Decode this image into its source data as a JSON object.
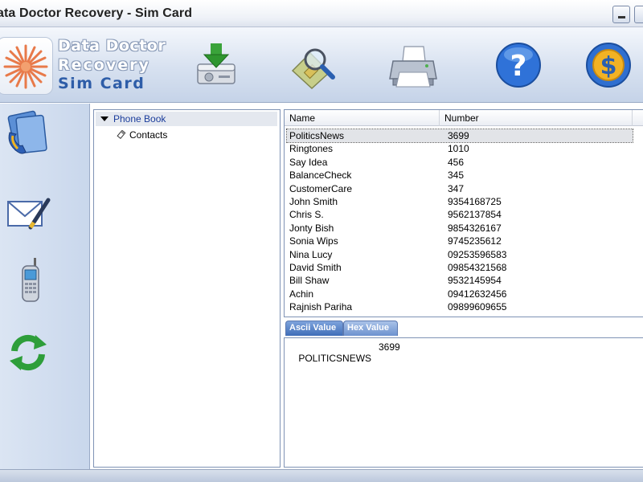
{
  "window": {
    "title": "ata Doctor Recovery - Sim Card"
  },
  "logo": {
    "line1": "Data Doctor",
    "line2": "Recovery",
    "line3": "Sim Card"
  },
  "toolbar": {
    "icons": [
      "save-icon",
      "search-icon",
      "print-icon",
      "help-icon",
      "buy-icon"
    ]
  },
  "leftbar": {
    "icons": [
      "contacts-icon",
      "message-icon",
      "mobile-phone-icon",
      "refresh-icon"
    ]
  },
  "tree": {
    "root_label": "Phone Book",
    "child_label": "Contacts"
  },
  "list": {
    "columns": [
      "Name",
      "Number"
    ],
    "rows": [
      {
        "name": "PoliticsNews",
        "number": "3699"
      },
      {
        "name": "Ringtones",
        "number": "1010"
      },
      {
        "name": "Say Idea",
        "number": "456"
      },
      {
        "name": "BalanceCheck",
        "number": "345"
      },
      {
        "name": "CustomerCare",
        "number": "347"
      },
      {
        "name": "John Smith",
        "number": "9354168725"
      },
      {
        "name": "Chris S.",
        "number": "9562137854"
      },
      {
        "name": "Jonty Bish",
        "number": "9854326167"
      },
      {
        "name": "Sonia Wips",
        "number": "9745235612"
      },
      {
        "name": "Nina Lucy",
        "number": "09253596583"
      },
      {
        "name": "David Smith",
        "number": "09854321568"
      },
      {
        "name": "Bill Shaw",
        "number": "9532145954"
      },
      {
        "name": "Achin",
        "number": "09412632456"
      },
      {
        "name": "Rajnish Pariha",
        "number": "09899609655"
      }
    ]
  },
  "tabs": {
    "ascii_label": "Ascii Value",
    "hex_label": "Hex Value"
  },
  "detail": {
    "name_value": "POLITICSNEWS",
    "number_value": "3699"
  },
  "colors": {
    "accent": "#2e5da8",
    "tree_root_text": "#1b3d9c",
    "panel_border": "#7f93b5"
  }
}
